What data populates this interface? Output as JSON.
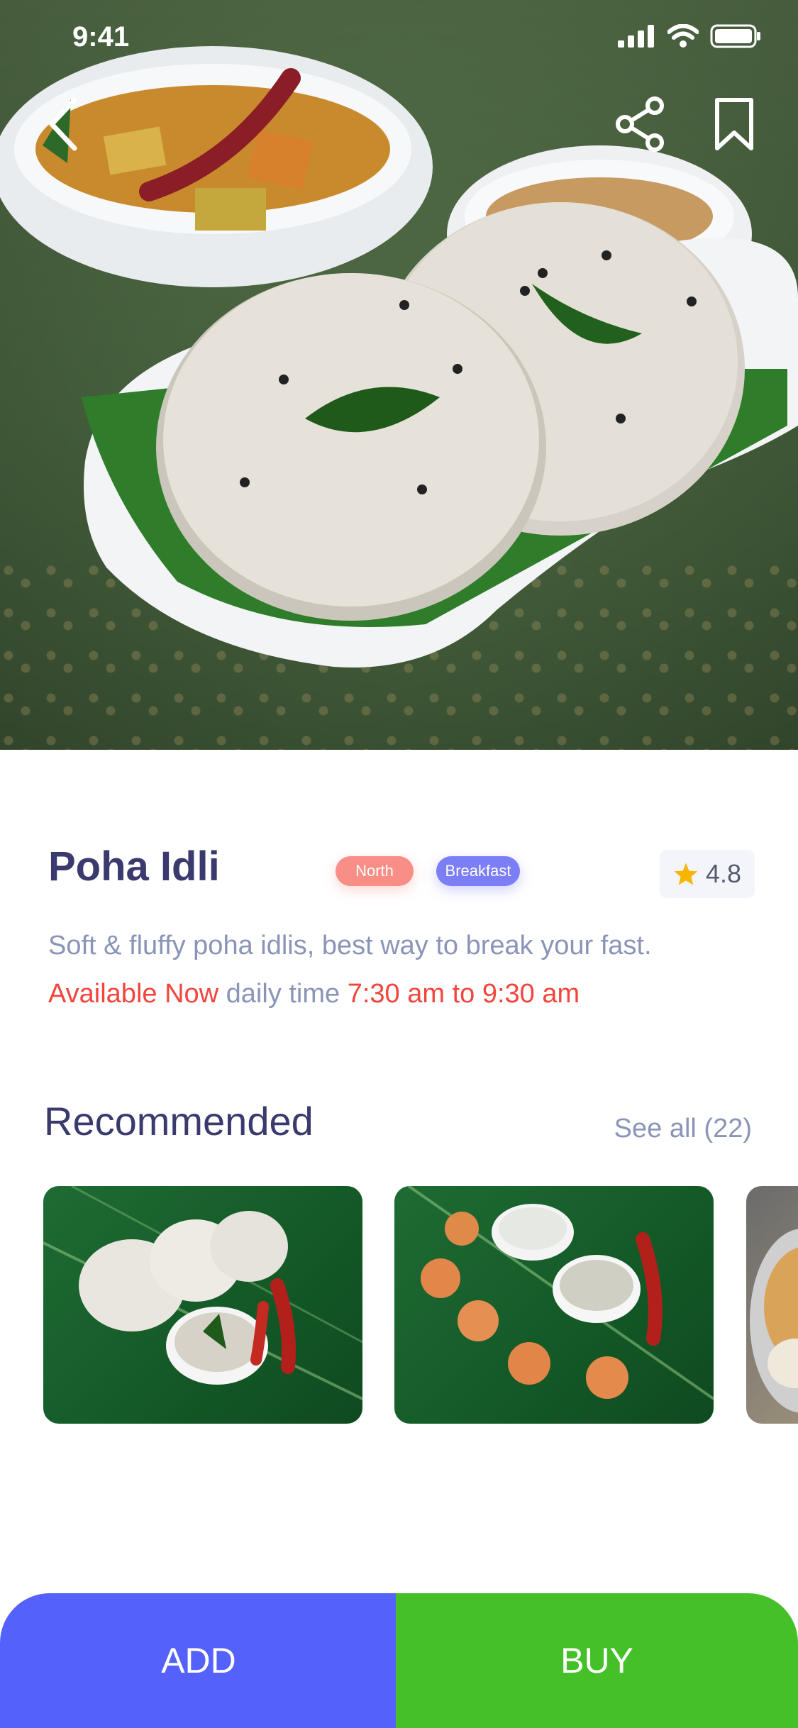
{
  "status_bar": {
    "time": "9:41"
  },
  "hero": {
    "back_icon": "chevron-left-icon",
    "share_icon": "share-icon",
    "bookmark_icon": "bookmark-icon"
  },
  "item": {
    "title": "Poha Idli",
    "tags": [
      "North",
      "Breakfast"
    ],
    "rating": "4.8",
    "description": "Soft & fluffy poha idlis, best way to break your fast.",
    "availability_status": "Available Now",
    "availability_label": " daily time ",
    "availability_time": "7:30 am to 9:30 am"
  },
  "recommended": {
    "title": "Recommended",
    "see_all": "See all (22)"
  },
  "actions": {
    "add_label": "ADD",
    "buy_label": "BUY"
  },
  "colors": {
    "title": "#3a3a6e",
    "muted": "#8a94b8",
    "red": "#f2453d",
    "add": "#5561fb",
    "buy": "#46c028",
    "tag_north": "#f88e86",
    "tag_breakfast": "#7b7ef5"
  }
}
